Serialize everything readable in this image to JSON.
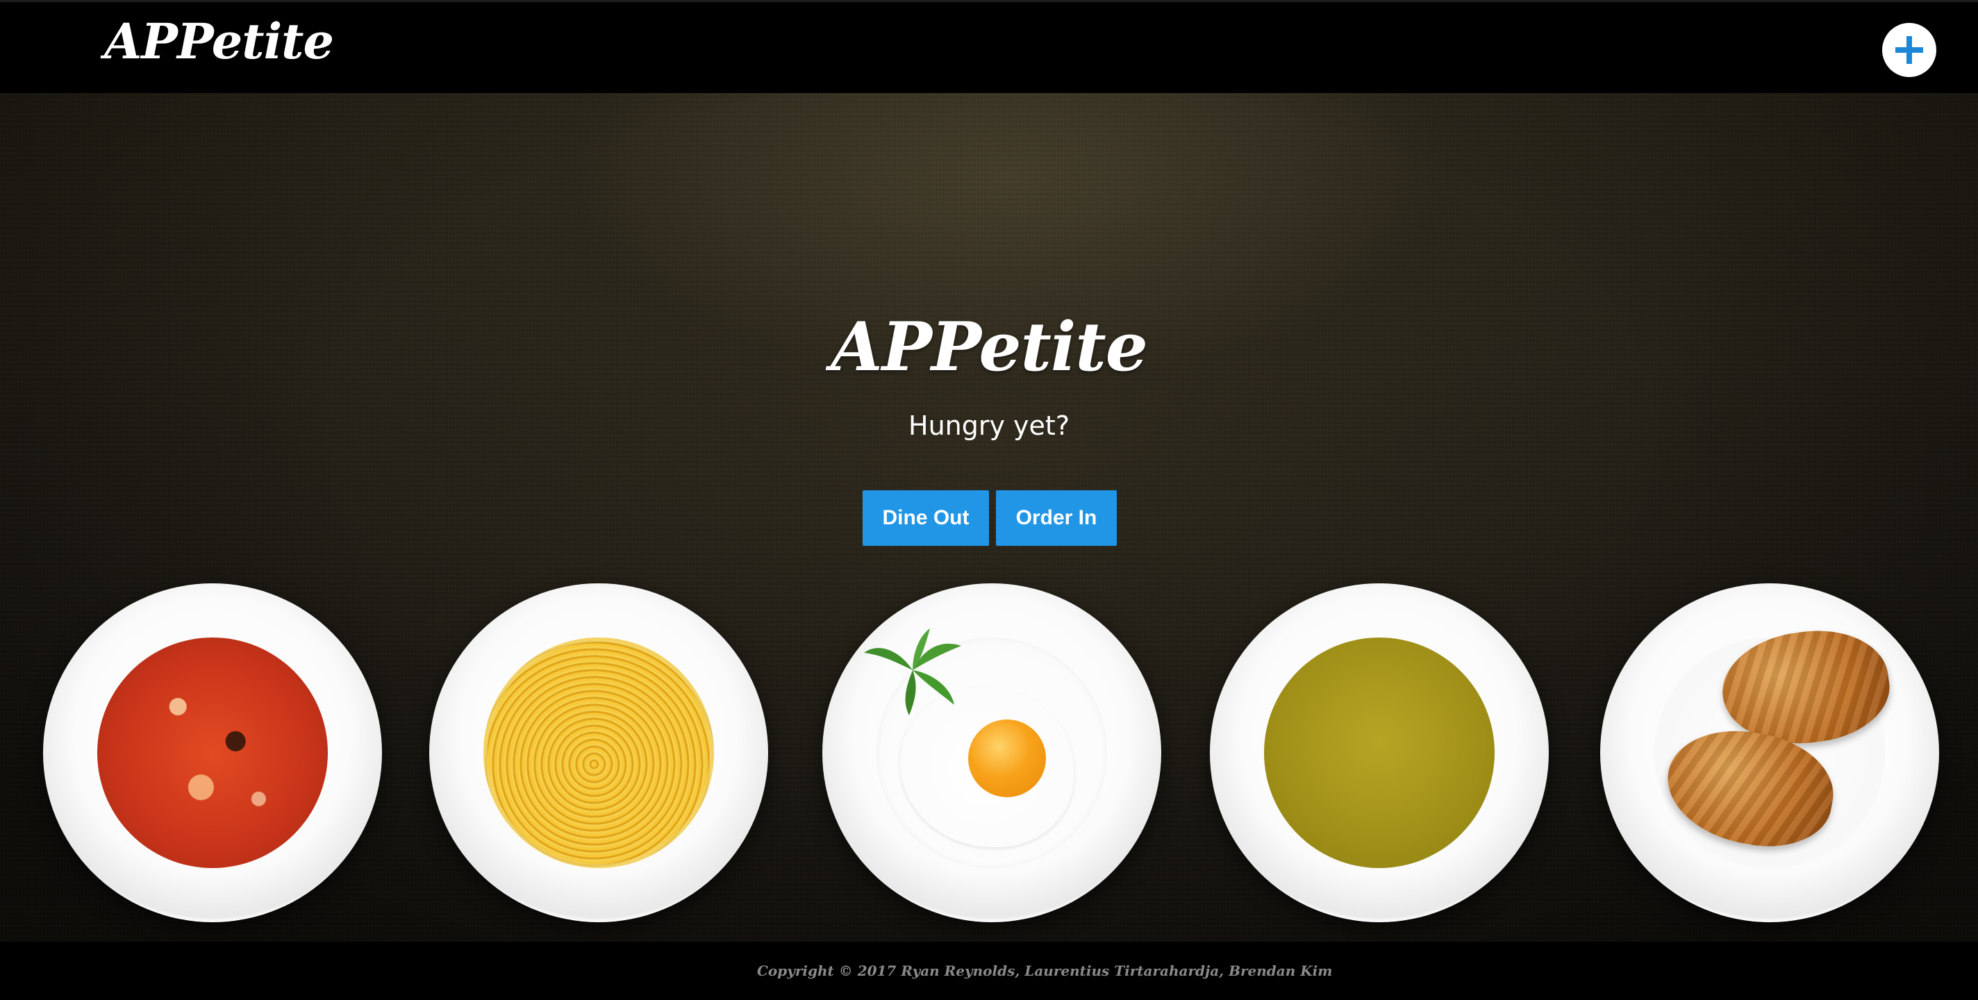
{
  "navbar": {
    "brand": "APPetite",
    "add_button_icon": "plus-icon"
  },
  "hero": {
    "title": "APPetite",
    "subtitle": "Hungry yet?",
    "buttons": [
      {
        "label": "Dine Out"
      },
      {
        "label": "Order In"
      }
    ]
  },
  "plates": [
    {
      "food": "vegetable soup"
    },
    {
      "food": "spaghetti"
    },
    {
      "food": "fried egg"
    },
    {
      "food": "pea puree soup"
    },
    {
      "food": "croissants"
    }
  ],
  "footer": {
    "copyright": "Copyright © 2017 Ryan Reynolds, Laurentius Tirtarahardja, Brendan Kim"
  },
  "colors": {
    "accent": "#2196e6",
    "plus_icon": "#1b87d6",
    "navbar_bg": "#000000",
    "footer_text": "#8a8a8a"
  }
}
